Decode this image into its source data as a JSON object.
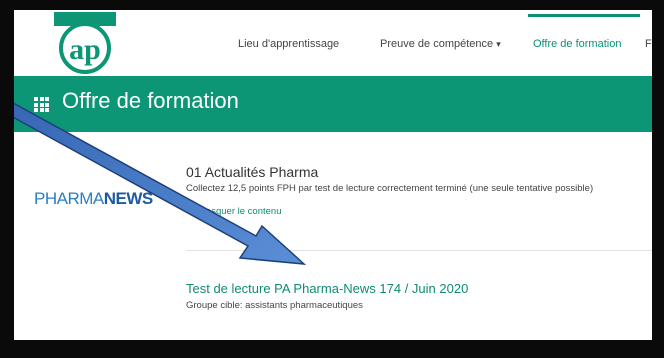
{
  "header": {
    "logo_text": "ap",
    "nav": {
      "lieu": "Lieu d'apprentissage",
      "preuve": "Preuve de compétence",
      "preuve_caret": "▾",
      "offre": "Offre de formation",
      "overflow": "F"
    }
  },
  "titlebar": {
    "title": "Offre de formation",
    "icon": "grid-icon"
  },
  "section": {
    "logo": {
      "part1": "PHARMA",
      "part2": "NEWS"
    },
    "title": "01 Actualités Pharma",
    "description": "Collectez 12,5 points FPH par test de lecture correctement terminé (une seule tentative possible)",
    "toggle_label": "▲ Masquer le contenu"
  },
  "course": {
    "title": "Test de lecture PA Pharma-News 174 / Juin 2020",
    "subtitle": "Groupe cible: assistants pharmaceutiques"
  },
  "colors": {
    "accent": "#0d9676",
    "link": "#0e8c73",
    "frame": "#0a0a0a",
    "arrow": "#3c6fbe"
  }
}
